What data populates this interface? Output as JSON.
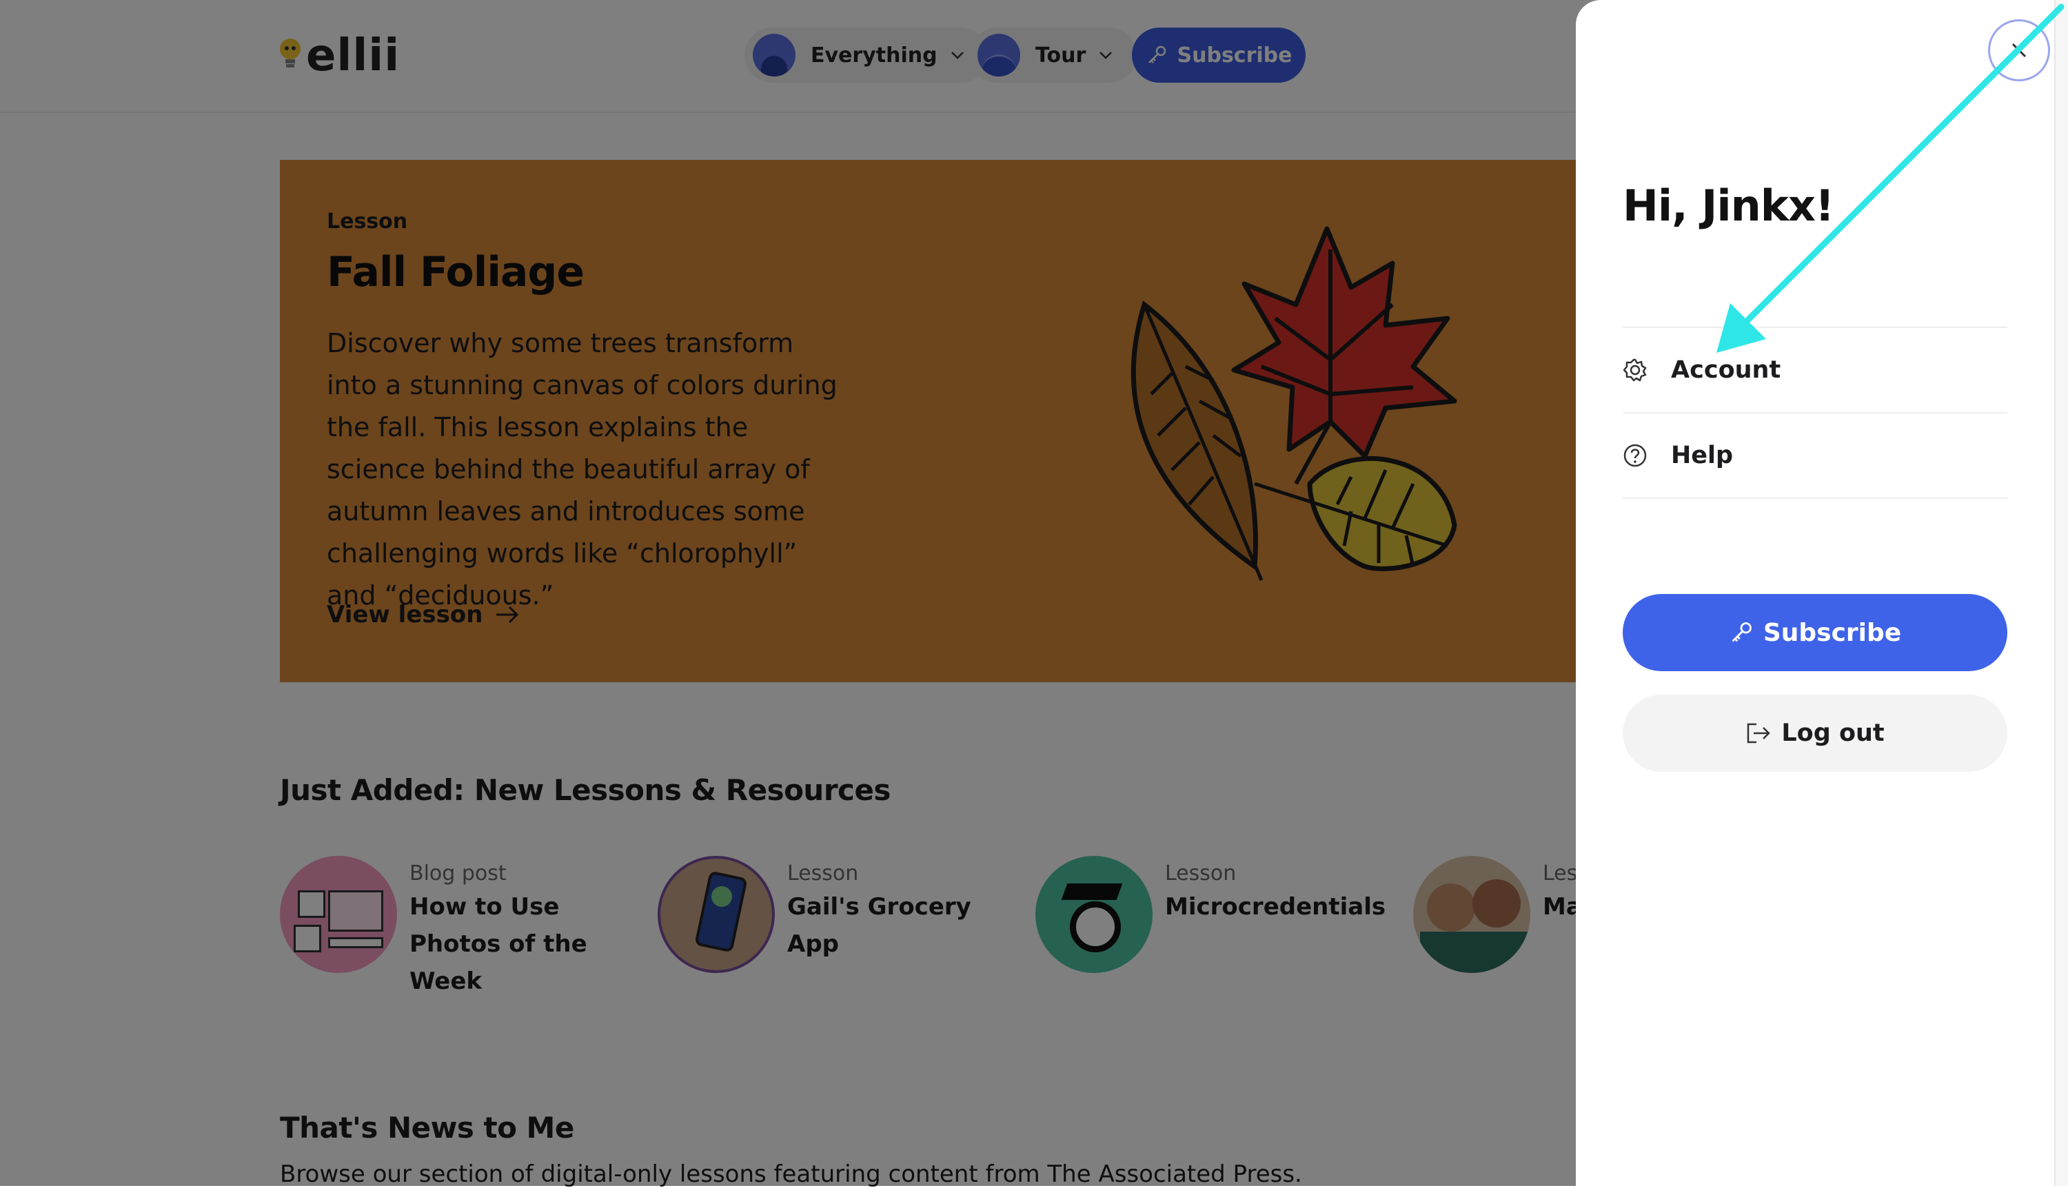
{
  "header": {
    "logo_text": "ellii",
    "nav": [
      {
        "label": "Everything"
      },
      {
        "label": "Tour"
      }
    ],
    "subscribe_label": "Subscribe"
  },
  "hero": {
    "type": "Lesson",
    "title": "Fall Foliage",
    "description": "Discover why some trees transform into a stunning canvas of colors during the fall. This lesson explains the science behind the beautiful array of autumn leaves and introduces some challenging words like “chlorophyll” and “deciduous.”",
    "link": "View lesson"
  },
  "just_added": {
    "title": "Just Added: New Lessons & Resources",
    "items": [
      {
        "type": "Blog post",
        "title": "How to Use Photos of the Week"
      },
      {
        "type": "Lesson",
        "title": "Gail's Grocery App"
      },
      {
        "type": "Lesson",
        "title": "Microcredentials"
      },
      {
        "type": "Less",
        "title": "Ma"
      }
    ]
  },
  "news": {
    "title": "That's News to Me",
    "subtitle": "Browse our section of digital-only lessons featuring content from The Associated Press."
  },
  "drawer": {
    "greeting": "Hi, Jinkx!",
    "menu": [
      {
        "label": "Account",
        "icon": "gear-icon"
      },
      {
        "label": "Help",
        "icon": "help-circle-icon"
      }
    ],
    "subscribe_label": "Subscribe",
    "logout_label": "Log out"
  },
  "colors": {
    "accent_blue": "#3f63e8",
    "hero_background": "#d88a3a",
    "annotation_arrow": "#2ee6e6"
  }
}
